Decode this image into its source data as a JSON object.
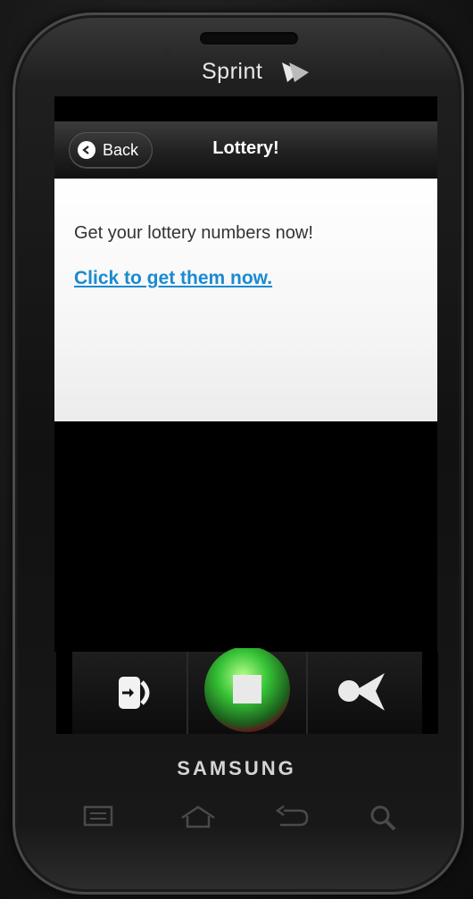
{
  "device": {
    "carrier": "Sprint",
    "manufacturer": "SAMSUNG"
  },
  "header": {
    "back_label": "Back",
    "title": "Lottery!"
  },
  "content": {
    "intro_text": "Get your lottery numbers now!",
    "link_text": "Click to get them now."
  },
  "dock": {
    "items": [
      {
        "icon": "exit-icon"
      },
      {
        "icon": "stop-record-icon"
      },
      {
        "icon": "share-icon"
      }
    ]
  },
  "hardware_keys": [
    {
      "icon": "menu-icon"
    },
    {
      "icon": "home-icon"
    },
    {
      "icon": "back-arrow-icon"
    },
    {
      "icon": "search-icon"
    }
  ],
  "colors": {
    "link": "#1a8ad1",
    "header_bg": "#222222",
    "record_button": "#4fd64f"
  }
}
